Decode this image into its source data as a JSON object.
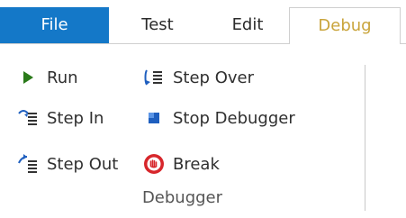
{
  "tabs": [
    {
      "label": "File"
    },
    {
      "label": "Test"
    },
    {
      "label": "Edit"
    },
    {
      "label": "Debug"
    }
  ],
  "group": {
    "label": "Debugger",
    "items": {
      "run": {
        "label": "Run",
        "icon": "play-icon"
      },
      "step_over": {
        "label": "Step Over",
        "icon": "step-over-icon"
      },
      "step_in": {
        "label": "Step In",
        "icon": "step-in-icon"
      },
      "stop_debugger": {
        "label": "Stop Debugger",
        "icon": "stop-icon"
      },
      "step_out": {
        "label": "Step Out",
        "icon": "step-out-icon"
      },
      "break": {
        "label": "Break",
        "icon": "break-icon"
      }
    }
  },
  "colors": {
    "file_tab_bg": "#1478c8",
    "debug_tab_text": "#c9a43b",
    "play_green": "#2a7a1a",
    "stop_blue": "#1f5fbf",
    "break_red": "#d7262b"
  }
}
